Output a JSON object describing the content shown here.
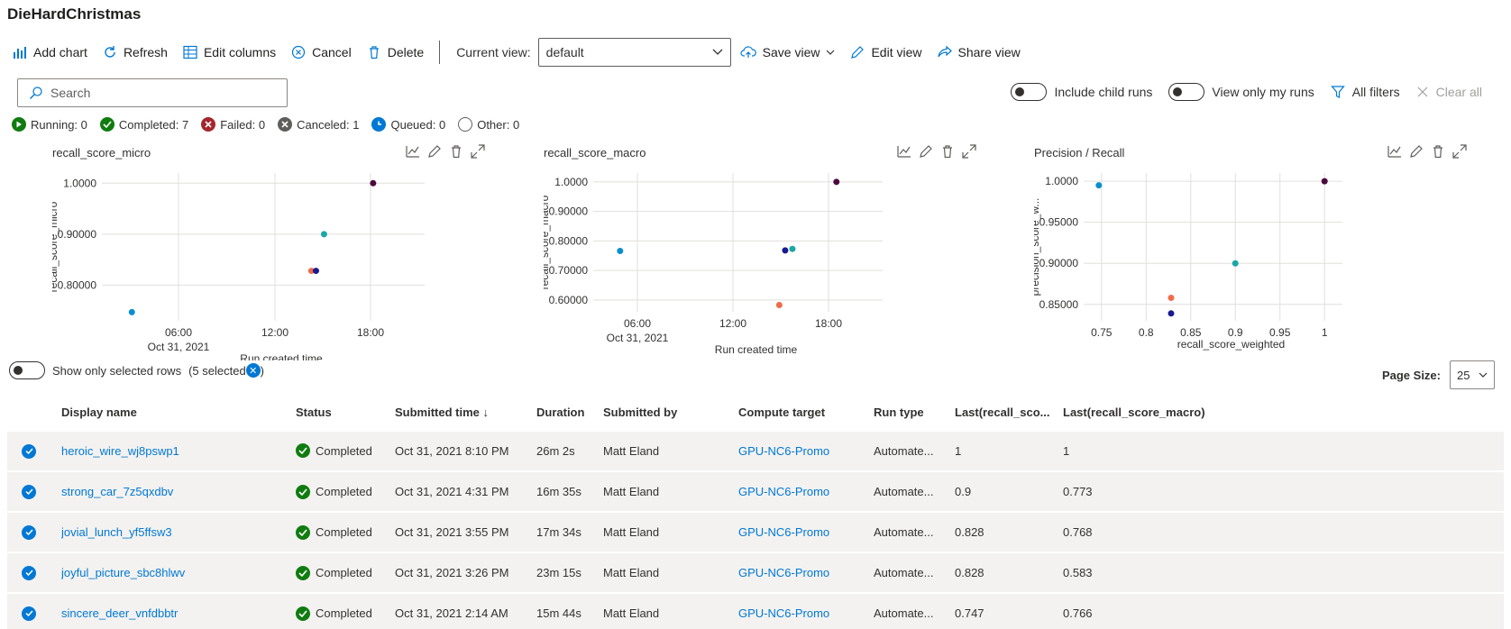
{
  "app": {
    "title": "DieHardChristmas"
  },
  "toolbar": {
    "add_chart": "Add chart",
    "refresh": "Refresh",
    "edit_columns": "Edit columns",
    "cancel": "Cancel",
    "delete": "Delete",
    "current_view_label": "Current view:",
    "current_view_value": "default",
    "save_view": "Save view",
    "edit_view": "Edit view",
    "share_view": "Share view"
  },
  "search": {
    "placeholder": "Search"
  },
  "filters": {
    "include_child_runs": "Include child runs",
    "view_only_my_runs": "View only my runs",
    "all_filters": "All filters",
    "clear_all": "Clear all"
  },
  "status_summary": [
    {
      "label": "Running: 0",
      "color": "#107c10",
      "icon": "play-icon"
    },
    {
      "label": "Completed: 7",
      "color": "#107c10",
      "icon": "check-icon"
    },
    {
      "label": "Failed: 0",
      "color": "#a4262c",
      "icon": "x-icon"
    },
    {
      "label": "Canceled: 1",
      "color": "#605e5c",
      "icon": "x-icon"
    },
    {
      "label": "Queued: 0",
      "color": "#0078d4",
      "icon": "clock-icon"
    },
    {
      "label": "Other: 0",
      "color": "#ffffff",
      "icon": "circle-icon"
    }
  ],
  "chart_data": [
    {
      "type": "scatter",
      "title": "recall_score_micro",
      "xlabel": "Run created time",
      "ylabel": "recall_score_micro",
      "x_ticks": [
        "06:00",
        "12:00",
        "18:00"
      ],
      "x_sublabel": "Oct 31, 2021",
      "y_ticks": [
        "1.0000",
        "0.90000",
        "0.80000"
      ],
      "xlim": [
        0.0,
        24.0
      ],
      "ylim": [
        0.73,
        1.02
      ],
      "grid": true,
      "points": [
        {
          "x": 2.23,
          "y": 0.747,
          "color": "#0b8ed1"
        },
        {
          "x": 15.58,
          "y": 0.828,
          "color": "#ef6c4a"
        },
        {
          "x": 15.92,
          "y": 0.828,
          "color": "#1a1a8f"
        },
        {
          "x": 16.52,
          "y": 0.9,
          "color": "#1aa7a7"
        },
        {
          "x": 20.17,
          "y": 1.0,
          "color": "#4a0a3f"
        }
      ]
    },
    {
      "type": "scatter",
      "title": "recall_score_macro",
      "xlabel": "Run created time",
      "ylabel": "recall_score_macro",
      "x_ticks": [
        "06:00",
        "12:00",
        "18:00"
      ],
      "x_sublabel": "Oct 31, 2021",
      "y_ticks": [
        "1.0000",
        "0.90000",
        "0.80000",
        "0.70000",
        "0.60000"
      ],
      "xlim": [
        0.0,
        24.0
      ],
      "ylim": [
        0.56,
        1.03
      ],
      "grid": true,
      "points": [
        {
          "x": 2.23,
          "y": 0.766,
          "color": "#0b8ed1"
        },
        {
          "x": 15.43,
          "y": 0.583,
          "color": "#ef6c4a"
        },
        {
          "x": 15.92,
          "y": 0.768,
          "color": "#1a1a8f"
        },
        {
          "x": 16.52,
          "y": 0.773,
          "color": "#1aa7a7"
        },
        {
          "x": 20.17,
          "y": 1.0,
          "color": "#4a0a3f"
        }
      ]
    },
    {
      "type": "scatter",
      "title": "Precision / Recall",
      "xlabel": "recall_score_weighted",
      "ylabel": "precision_score_w...",
      "x_ticks": [
        "0.75",
        "0.8",
        "0.85",
        "0.9",
        "0.95",
        "1"
      ],
      "y_ticks": [
        "1.0000",
        "0.95000",
        "0.90000",
        "0.85000"
      ],
      "xlim": [
        0.73,
        1.02
      ],
      "ylim": [
        0.83,
        1.01
      ],
      "grid": true,
      "points": [
        {
          "x": 0.747,
          "y": 0.995,
          "color": "#0b8ed1"
        },
        {
          "x": 0.828,
          "y": 0.858,
          "color": "#ef6c4a"
        },
        {
          "x": 0.828,
          "y": 0.839,
          "color": "#1a1a8f"
        },
        {
          "x": 0.9,
          "y": 0.9,
          "color": "#1aa7a7"
        },
        {
          "x": 1.0,
          "y": 1.0,
          "color": "#4a0a3f"
        }
      ]
    }
  ],
  "selection": {
    "label": "Show only selected rows",
    "count_prefix": "(5 selected",
    "count_suffix": ")"
  },
  "paging": {
    "label": "Page Size:",
    "value": "25"
  },
  "table": {
    "columns": [
      "Display name",
      "Status",
      "Submitted time ↓",
      "Duration",
      "Submitted by",
      "Compute target",
      "Run type",
      "Last(recall_sco...",
      "Last(recall_score_macro)"
    ],
    "rows": [
      [
        "heroic_wire_wj8pswp1",
        "Completed",
        "Oct 31, 2021 8:10 PM",
        "26m 2s",
        "Matt Eland",
        "GPU-NC6-Promo",
        "Automate...",
        "1",
        "1"
      ],
      [
        "strong_car_7z5qxdbv",
        "Completed",
        "Oct 31, 2021 4:31 PM",
        "16m 35s",
        "Matt Eland",
        "GPU-NC6-Promo",
        "Automate...",
        "0.9",
        "0.773"
      ],
      [
        "jovial_lunch_yf5ffsw3",
        "Completed",
        "Oct 31, 2021 3:55 PM",
        "17m 34s",
        "Matt Eland",
        "GPU-NC6-Promo",
        "Automate...",
        "0.828",
        "0.768"
      ],
      [
        "joyful_picture_sbc8hlwv",
        "Completed",
        "Oct 31, 2021 3:26 PM",
        "23m 15s",
        "Matt Eland",
        "GPU-NC6-Promo",
        "Automate...",
        "0.828",
        "0.583"
      ],
      [
        "sincere_deer_vnfdbbtr",
        "Completed",
        "Oct 31, 2021 2:14 AM",
        "15m 44s",
        "Matt Eland",
        "GPU-NC6-Promo",
        "Automate...",
        "0.747",
        "0.766"
      ]
    ]
  }
}
